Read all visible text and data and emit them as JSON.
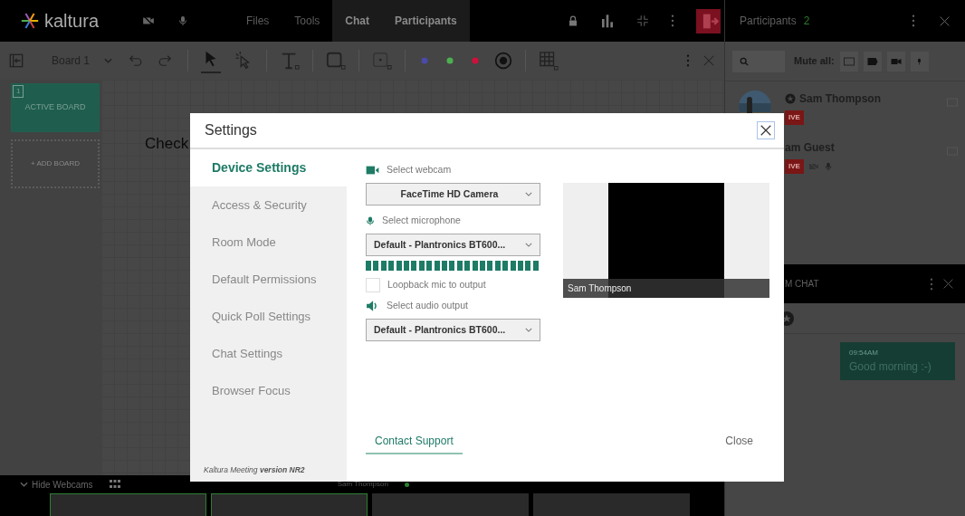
{
  "topbar": {
    "logo": "kaltura",
    "tabs": [
      {
        "label": "Files",
        "open": false
      },
      {
        "label": "Tools",
        "open": false
      },
      {
        "label": "Chat",
        "open": true
      },
      {
        "label": "Participants",
        "open": true
      }
    ]
  },
  "toolbar": {
    "board": "Board 1",
    "tools": [
      {
        "kind": "pointer",
        "selected": true
      },
      {
        "kind": "lasso",
        "selected": false
      },
      {
        "kind": "text",
        "selected": false
      },
      {
        "kind": "shape",
        "selected": false
      },
      {
        "kind": "stamp",
        "selected": false
      }
    ],
    "colors": [
      {
        "color": "#4a4aa8"
      },
      {
        "color": "#4caf50"
      },
      {
        "color": "#d0103a"
      }
    ]
  },
  "boards": [
    {
      "kind": "active",
      "number": "1",
      "label": "ACTIVE BOARD"
    },
    {
      "kind": "add",
      "label": "+ ADD BOARD"
    }
  ],
  "canvas_text": "Check",
  "webcams": {
    "toggle": "Hide Webcams",
    "speaker": "Sam Thompson",
    "tiles": [
      {
        "active": true
      },
      {
        "active": true
      },
      {
        "active": false
      },
      {
        "active": false
      }
    ]
  },
  "participants": {
    "title": "Participants",
    "count": "2",
    "mute_label": "Mute all:",
    "people": [
      {
        "name": "Sam Thompson",
        "badge": "IVE",
        "moderator": true,
        "avatar": true
      },
      {
        "name": "am Guest",
        "badge": "IVE",
        "moderator": false
      }
    ]
  },
  "chat": {
    "title": "M CHAT",
    "messages": [
      {
        "time": "09:54AM",
        "text": "Good morning :-)"
      }
    ]
  },
  "settings": {
    "title": "Settings",
    "nav": [
      {
        "label": "Device Settings",
        "selected": true
      },
      {
        "label": "Access & Security",
        "selected": false
      },
      {
        "label": "Room Mode",
        "selected": false
      },
      {
        "label": "Default Permissions",
        "selected": false
      },
      {
        "label": "Quick Poll Settings",
        "selected": false
      },
      {
        "label": "Chat Settings",
        "selected": false
      },
      {
        "label": "Browser Focus",
        "selected": false
      }
    ],
    "version": "Kaltura Meeting **version NR2**",
    "webcam_label": "Select webcam",
    "webcam": "FaceTime HD Camera",
    "mic_label": "Select microphone",
    "mic": "Default - Plantronics BT600...",
    "mic_meter": {
      "level": 1
    },
    "loopback": {
      "label": "Loopback mic to output",
      "checked": false
    },
    "audio_label": "Select audio output",
    "audio": "Default - Plantronics BT600...",
    "preview_name": "Sam Thompson",
    "contact": "Contact Support",
    "close": "Close"
  }
}
